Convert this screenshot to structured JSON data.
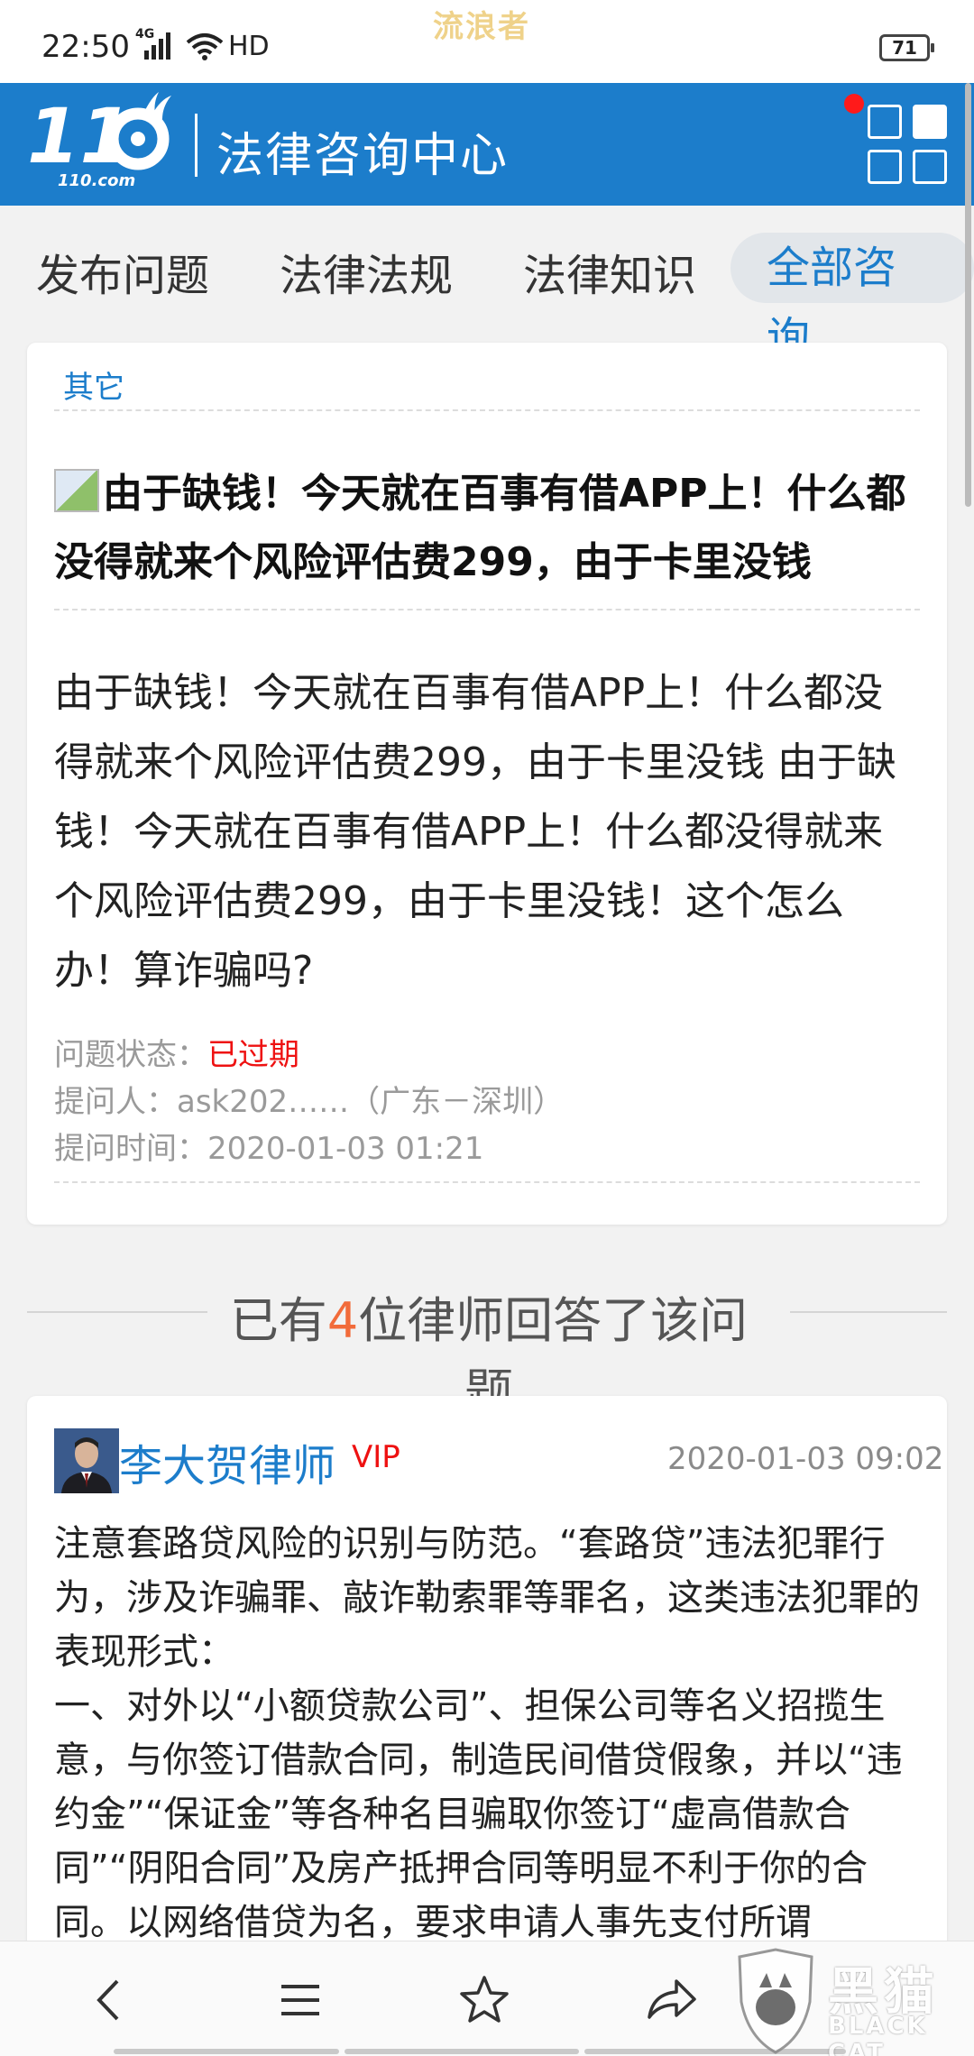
{
  "status_bar": {
    "time": "22:50",
    "network": "4G",
    "hd": "HD",
    "watermark": "流浪者",
    "battery": "71"
  },
  "header": {
    "logo_text": "110.com",
    "title": "法律咨询中心",
    "brand_color": "#1c7dcb"
  },
  "tabs": [
    {
      "label": "发布问题"
    },
    {
      "label": "法律法规"
    },
    {
      "label": "法律知识"
    },
    {
      "label": "全部咨询",
      "active": true
    }
  ],
  "question": {
    "category": "其它",
    "title": "由于缺钱！今天就在百事有借APP上！什么都没得就来个风险评估费299，由于卡里没钱",
    "body": "由于缺钱！今天就在百事有借APP上！什么都没得就来个风险评估费299，由于卡里没钱 由于缺钱！今天就在百事有借APP上！什么都没得就来个风险评估费299，由于卡里没钱！这个怎么办！算诈骗吗?",
    "status_label": "问题状态：",
    "status_value": "已过期",
    "asker": "提问人：ask202……（广东－深圳）",
    "time": "提问时间：2020-01-03 01:21"
  },
  "answers_header": {
    "prefix": "已有",
    "count": "4",
    "suffix": "位律师回答了该问题"
  },
  "answer": {
    "lawyer": "李大贺律师",
    "vip": "VIP",
    "time": "2020-01-03 09:02",
    "body": "注意套路贷风险的识别与防范。“套路贷”违法犯罪行为，涉及诈骗罪、敲诈勒索罪等罪名，这类违法犯罪的表现形式：\n一、对外以“小额贷款公司”、担保公司等名义招揽生意，与你签订借款合同，制造民间借贷假象，并以“违约金”“保证金”等各种名目骗取你签订“虚高借款合同”“阴阳合同”及房产抵押合同等明显不利于你的合同。以网络借贷为名，要求申请人事先支付所谓"
  },
  "bottom_nav": {
    "icons": [
      "back-icon",
      "menu-icon",
      "star-icon",
      "share-icon"
    ]
  },
  "corner_watermark": {
    "text_cn": "黑猫",
    "text_en": "BLACK CAT"
  }
}
